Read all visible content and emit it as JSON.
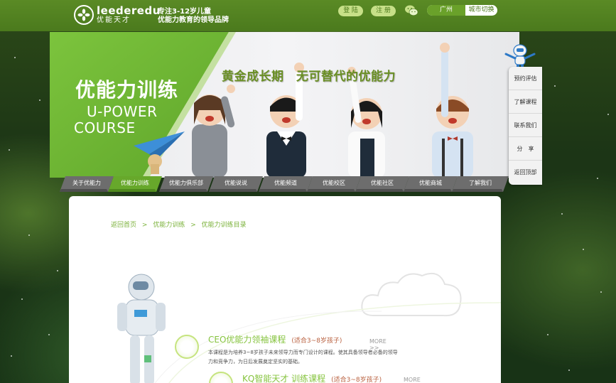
{
  "header": {
    "logo_en": "leederedu",
    "logo_cn": "优能天才",
    "slogan_line1": "专注3-12岁儿童",
    "slogan_line2": "优能力教育的领导品牌",
    "login_label": "登 陆",
    "register_label": "注 册",
    "city_name": "广州",
    "city_switch_label": "城市切换"
  },
  "banner": {
    "title_cn": "优能力训练",
    "title_en_line1": "U-POWER",
    "title_en_line2": "COURSE",
    "slogan": "黄金成长期　无可替代的优能力"
  },
  "nav": {
    "items": [
      {
        "label": "关于优能力"
      },
      {
        "label": "优能力训练"
      },
      {
        "label": "优能力俱乐部"
      },
      {
        "label": "优能说说"
      },
      {
        "label": "优能频道"
      },
      {
        "label": "优能校区"
      },
      {
        "label": "优能社区"
      },
      {
        "label": "优能商城"
      },
      {
        "label": "了解我们"
      }
    ],
    "active_index": 1
  },
  "side_menu": {
    "items": [
      {
        "label": "预约评估"
      },
      {
        "label": "了解课程"
      },
      {
        "label": "联系我们"
      },
      {
        "label": "分　享"
      },
      {
        "label": "返回顶部"
      }
    ]
  },
  "breadcrumb": {
    "items": [
      "返回首页",
      "优能力训练",
      "优能力训练目录"
    ],
    "separator": ">"
  },
  "courses": [
    {
      "title": "CEO优能力领袖课程",
      "age": "(适合3~8岁孩子)",
      "more": "MORE >>",
      "desc": "本课程是为培养3~8岁孩子未来领导力而专门设计的课程。使其具备领导者必备的领导力和竞争力，为日后发展奠定坚实的基础。"
    },
    {
      "title": "KQ智能天才 训练课程",
      "age": "(适合3~8岁孩子)",
      "more": "MORE >>",
      "desc": ""
    }
  ],
  "colors": {
    "brand_green": "#6aa12a",
    "light_green": "#c7e088",
    "text_green": "#7bb23a",
    "course_title": "#87c440",
    "age_text": "#b9603f"
  },
  "icons": {
    "logo": "leaf-logo-icon",
    "wechat": "wechat-icon",
    "robot": "robot-mascot-icon",
    "plane": "paper-plane-icon"
  }
}
